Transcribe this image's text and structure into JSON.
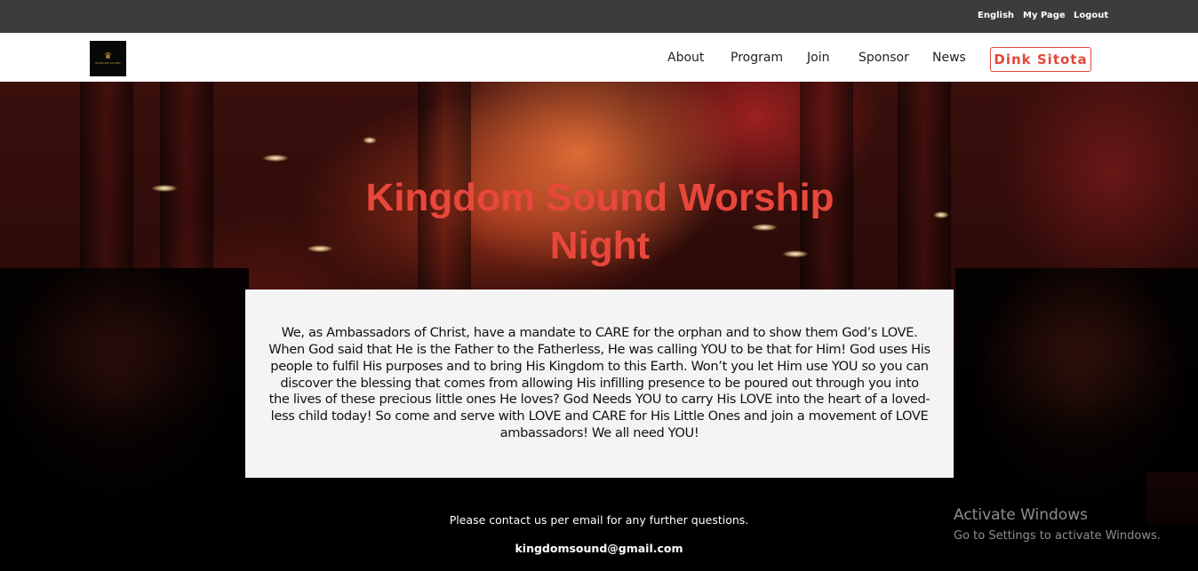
{
  "topbar": {
    "links": [
      "English",
      "My Page",
      "Logout"
    ]
  },
  "navbar": {
    "logo_text": "KINGDOM SOUND",
    "items": [
      "About",
      "Program",
      "Join",
      "Sponsor",
      "News"
    ],
    "user_button": "Dink Sitota"
  },
  "hero": {
    "title": "Kingdom Sound Worship Night",
    "message": "We, as Ambassadors of Christ, have a mandate to CARE for the orphan and to show them God’s LOVE. When God said that He is the Father to the Fatherless, He was calling YOU to be that for Him! God uses His people to fulfil His purposes and to bring His Kingdom to this Earth. Won’t you let Him use YOU so you can discover the blessing that comes from allowing His infilling presence to be poured out through you into the lives of these precious little ones He loves? God Needs YOU to carry His LOVE into the heart of a loved-less child today! So come and serve with LOVE and CARE for His Little Ones and join a movement of LOVE ambassadors! We all need YOU!",
    "contact_text": "Please contact us per email for any further questions.",
    "contact_email": "kingdomsound@gmail.com"
  },
  "watermark": {
    "title": "Activate Windows",
    "subtitle": "Go to Settings to activate Windows."
  },
  "colors": {
    "accent": "#e8473b",
    "topbar": "#3c3c3c"
  },
  "icons": {
    "logo": "crown-icon"
  }
}
